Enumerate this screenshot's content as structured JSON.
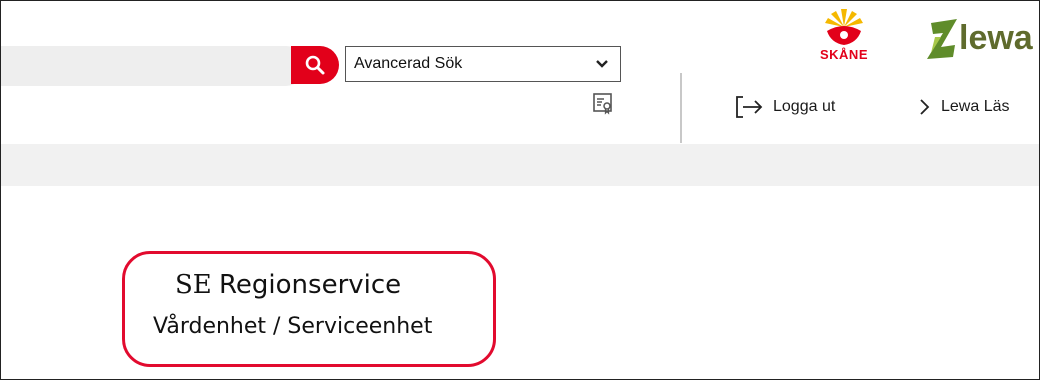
{
  "header": {
    "search": {
      "value": "",
      "placeholder": ""
    },
    "search_button_icon": "search-icon",
    "search_type_select": {
      "selected": "Avancerad Sök"
    },
    "certificate_icon": "certificate-icon",
    "logout": {
      "icon": "logout-icon",
      "label": "Logga ut"
    },
    "lewa_link": {
      "icon": "chevron-right-icon",
      "label": "Lewa Läs"
    },
    "logos": {
      "region_skane": {
        "text": "SKÅNE",
        "color": "#e2001a"
      },
      "lewa": {
        "text": "lewa",
        "color": "#5f6b2d"
      }
    }
  },
  "unit": {
    "prefix": "SE",
    "name": "Regionservice",
    "subtitle": "Vårdenhet / Serviceenhet",
    "highlight_color": "#e20a2e"
  },
  "colors": {
    "accent": "#e2001a",
    "band": "#f1f1f1"
  }
}
